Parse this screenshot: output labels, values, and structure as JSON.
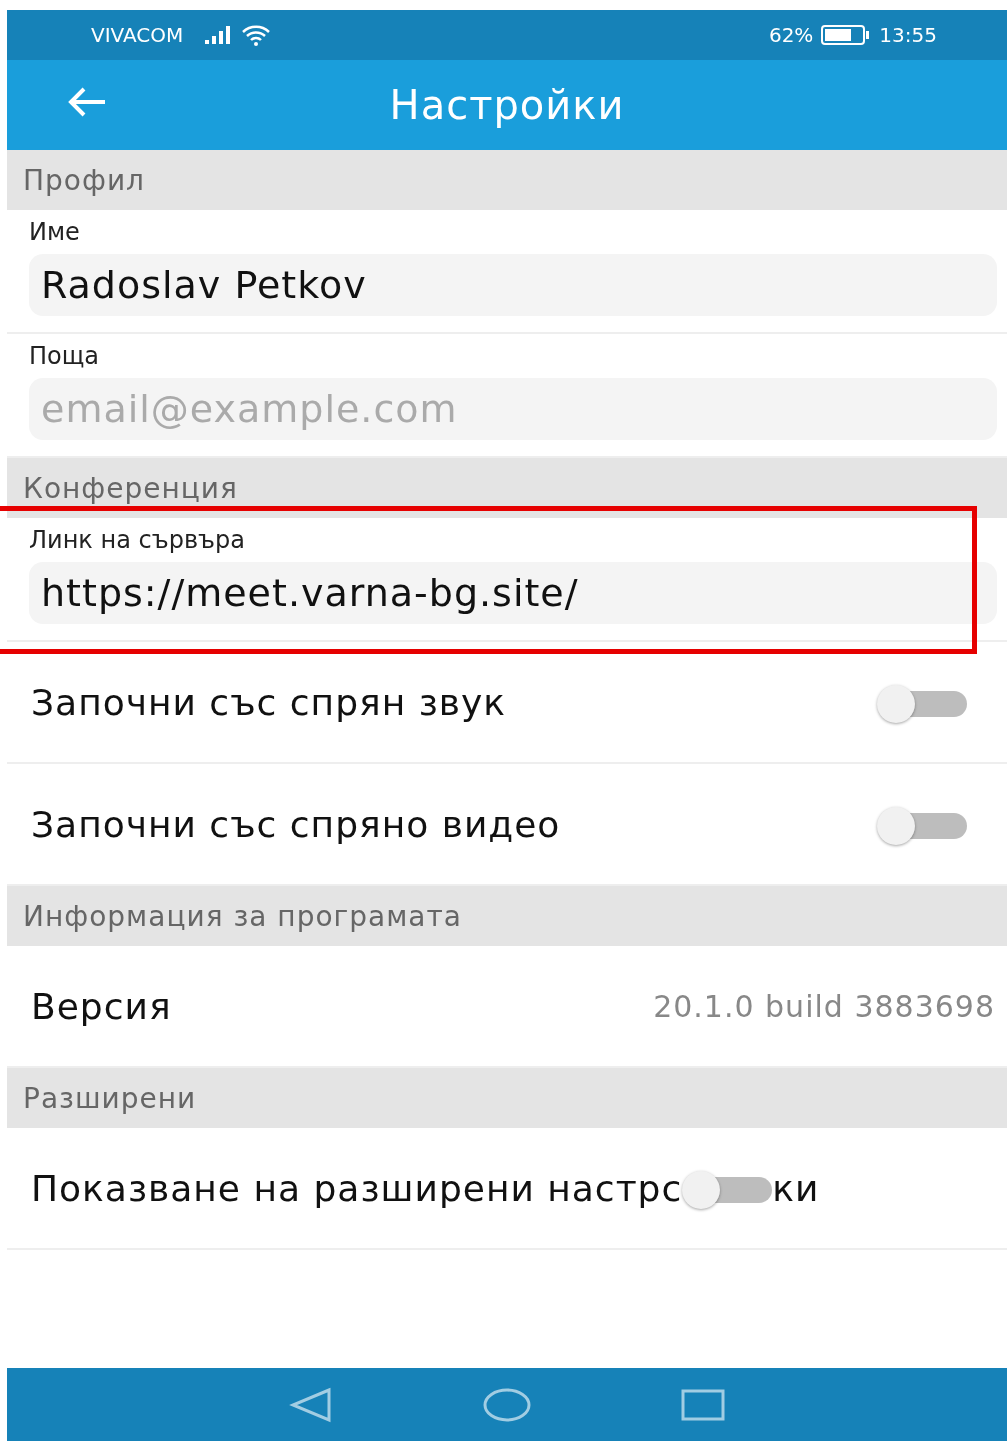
{
  "status_bar": {
    "carrier": "VIVACOM",
    "battery": "62%",
    "time": "13:55"
  },
  "app_bar": {
    "title": "Настройки"
  },
  "sections": [
    {
      "title": "Профил",
      "items": [
        {
          "kind": "field",
          "label": "Име",
          "value": "Radoslav Petkov",
          "highlighted": false
        },
        {
          "kind": "field",
          "label": "Поща",
          "placeholder": "email@example.com",
          "highlighted": false
        }
      ]
    },
    {
      "title": "Конференция",
      "items": [
        {
          "kind": "field",
          "label": "Линк на сървъра",
          "value": "https://meet.varna-bg.site/",
          "highlighted": true
        },
        {
          "kind": "toggle",
          "label": "Започни със спрян звук",
          "on": false
        },
        {
          "kind": "toggle",
          "label": "Започни със спряно видео",
          "on": false
        }
      ]
    },
    {
      "title": "Информация за програмата",
      "items": [
        {
          "kind": "info",
          "label": "Версия",
          "value": "20.1.0 build 3883698"
        }
      ]
    },
    {
      "title": "Разширени",
      "items": [
        {
          "kind": "covered_toggle",
          "label": "Показване на разширени настрс",
          "label_end": "ки",
          "on": false
        }
      ]
    }
  ]
}
